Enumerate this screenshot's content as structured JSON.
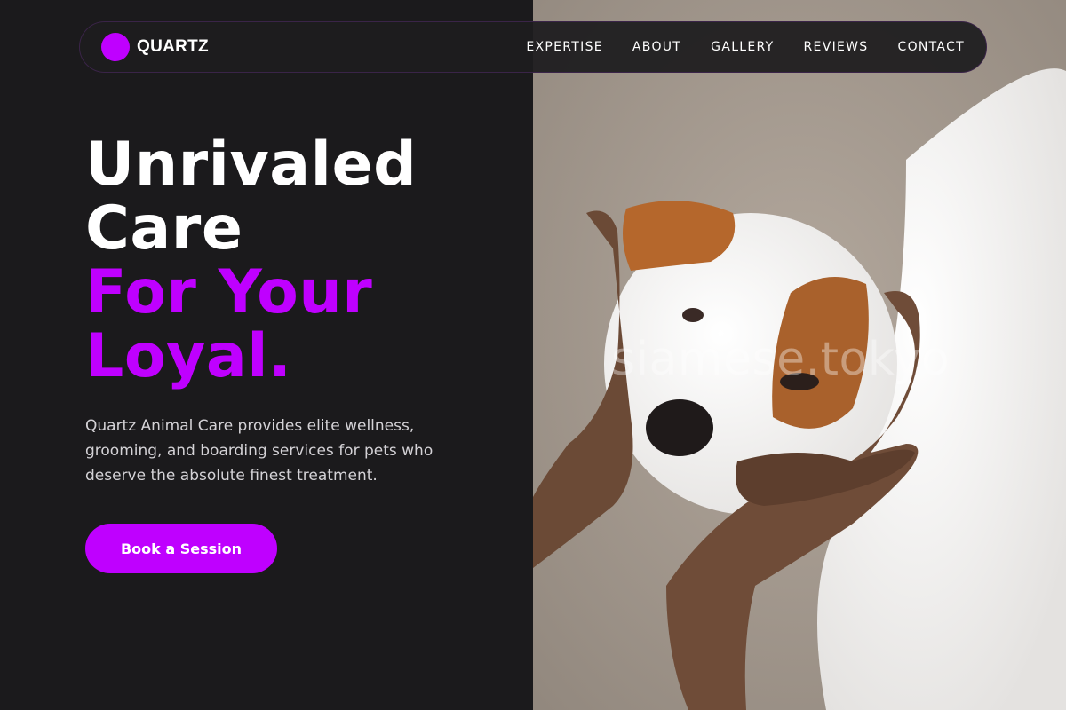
{
  "brand": {
    "name": "QUARTZ",
    "logo_color": "#bf00ff"
  },
  "nav": {
    "links": [
      {
        "label": "EXPERTISE"
      },
      {
        "label": "ABOUT"
      },
      {
        "label": "GALLERY"
      },
      {
        "label": "REVIEWS"
      },
      {
        "label": "CONTACT"
      }
    ]
  },
  "hero": {
    "title_line1": "Unrivaled",
    "title_line2": "Care",
    "title_line3": "For Your",
    "title_line4": "Loyal.",
    "description": "Quartz Animal Care provides elite wellness, grooming, and boarding services for pets who deserve the absolute finest treatment.",
    "cta_label": "Book a Session"
  },
  "photo": {
    "subject": "white puppy held in hands",
    "watermark": "siamese.tokyo"
  },
  "colors": {
    "accent": "#bf00ff",
    "background": "#1b1a1c",
    "text": "#ffffff",
    "muted_text": "#d4d2d6"
  }
}
